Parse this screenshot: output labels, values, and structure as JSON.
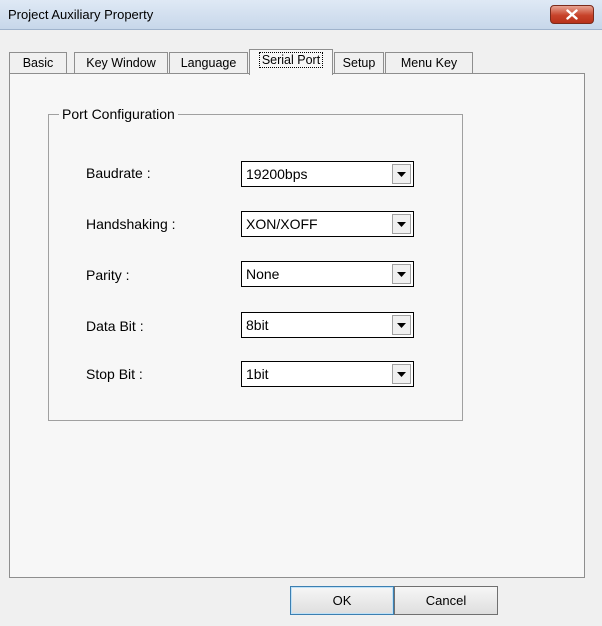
{
  "window": {
    "title": "Project Auxiliary Property"
  },
  "tabs": [
    {
      "label": "Basic"
    },
    {
      "label": "Key Window"
    },
    {
      "label": "Language"
    },
    {
      "label": "Serial Port",
      "active": true
    },
    {
      "label": "Setup"
    },
    {
      "label": "Menu Key"
    }
  ],
  "port_configuration": {
    "legend": "Port Configuration",
    "fields": [
      {
        "label": "Baudrate :",
        "value": "19200bps"
      },
      {
        "label": "Handshaking :",
        "value": "XON/XOFF"
      },
      {
        "label": "Parity :",
        "value": "None"
      },
      {
        "label": "Data Bit :",
        "value": "8bit"
      },
      {
        "label": "Stop Bit :",
        "value": "1bit"
      }
    ]
  },
  "buttons": {
    "ok": "OK",
    "cancel": "Cancel"
  },
  "icons": {
    "close": "close-icon",
    "dropdown": "dropdown-arrow-icon"
  }
}
